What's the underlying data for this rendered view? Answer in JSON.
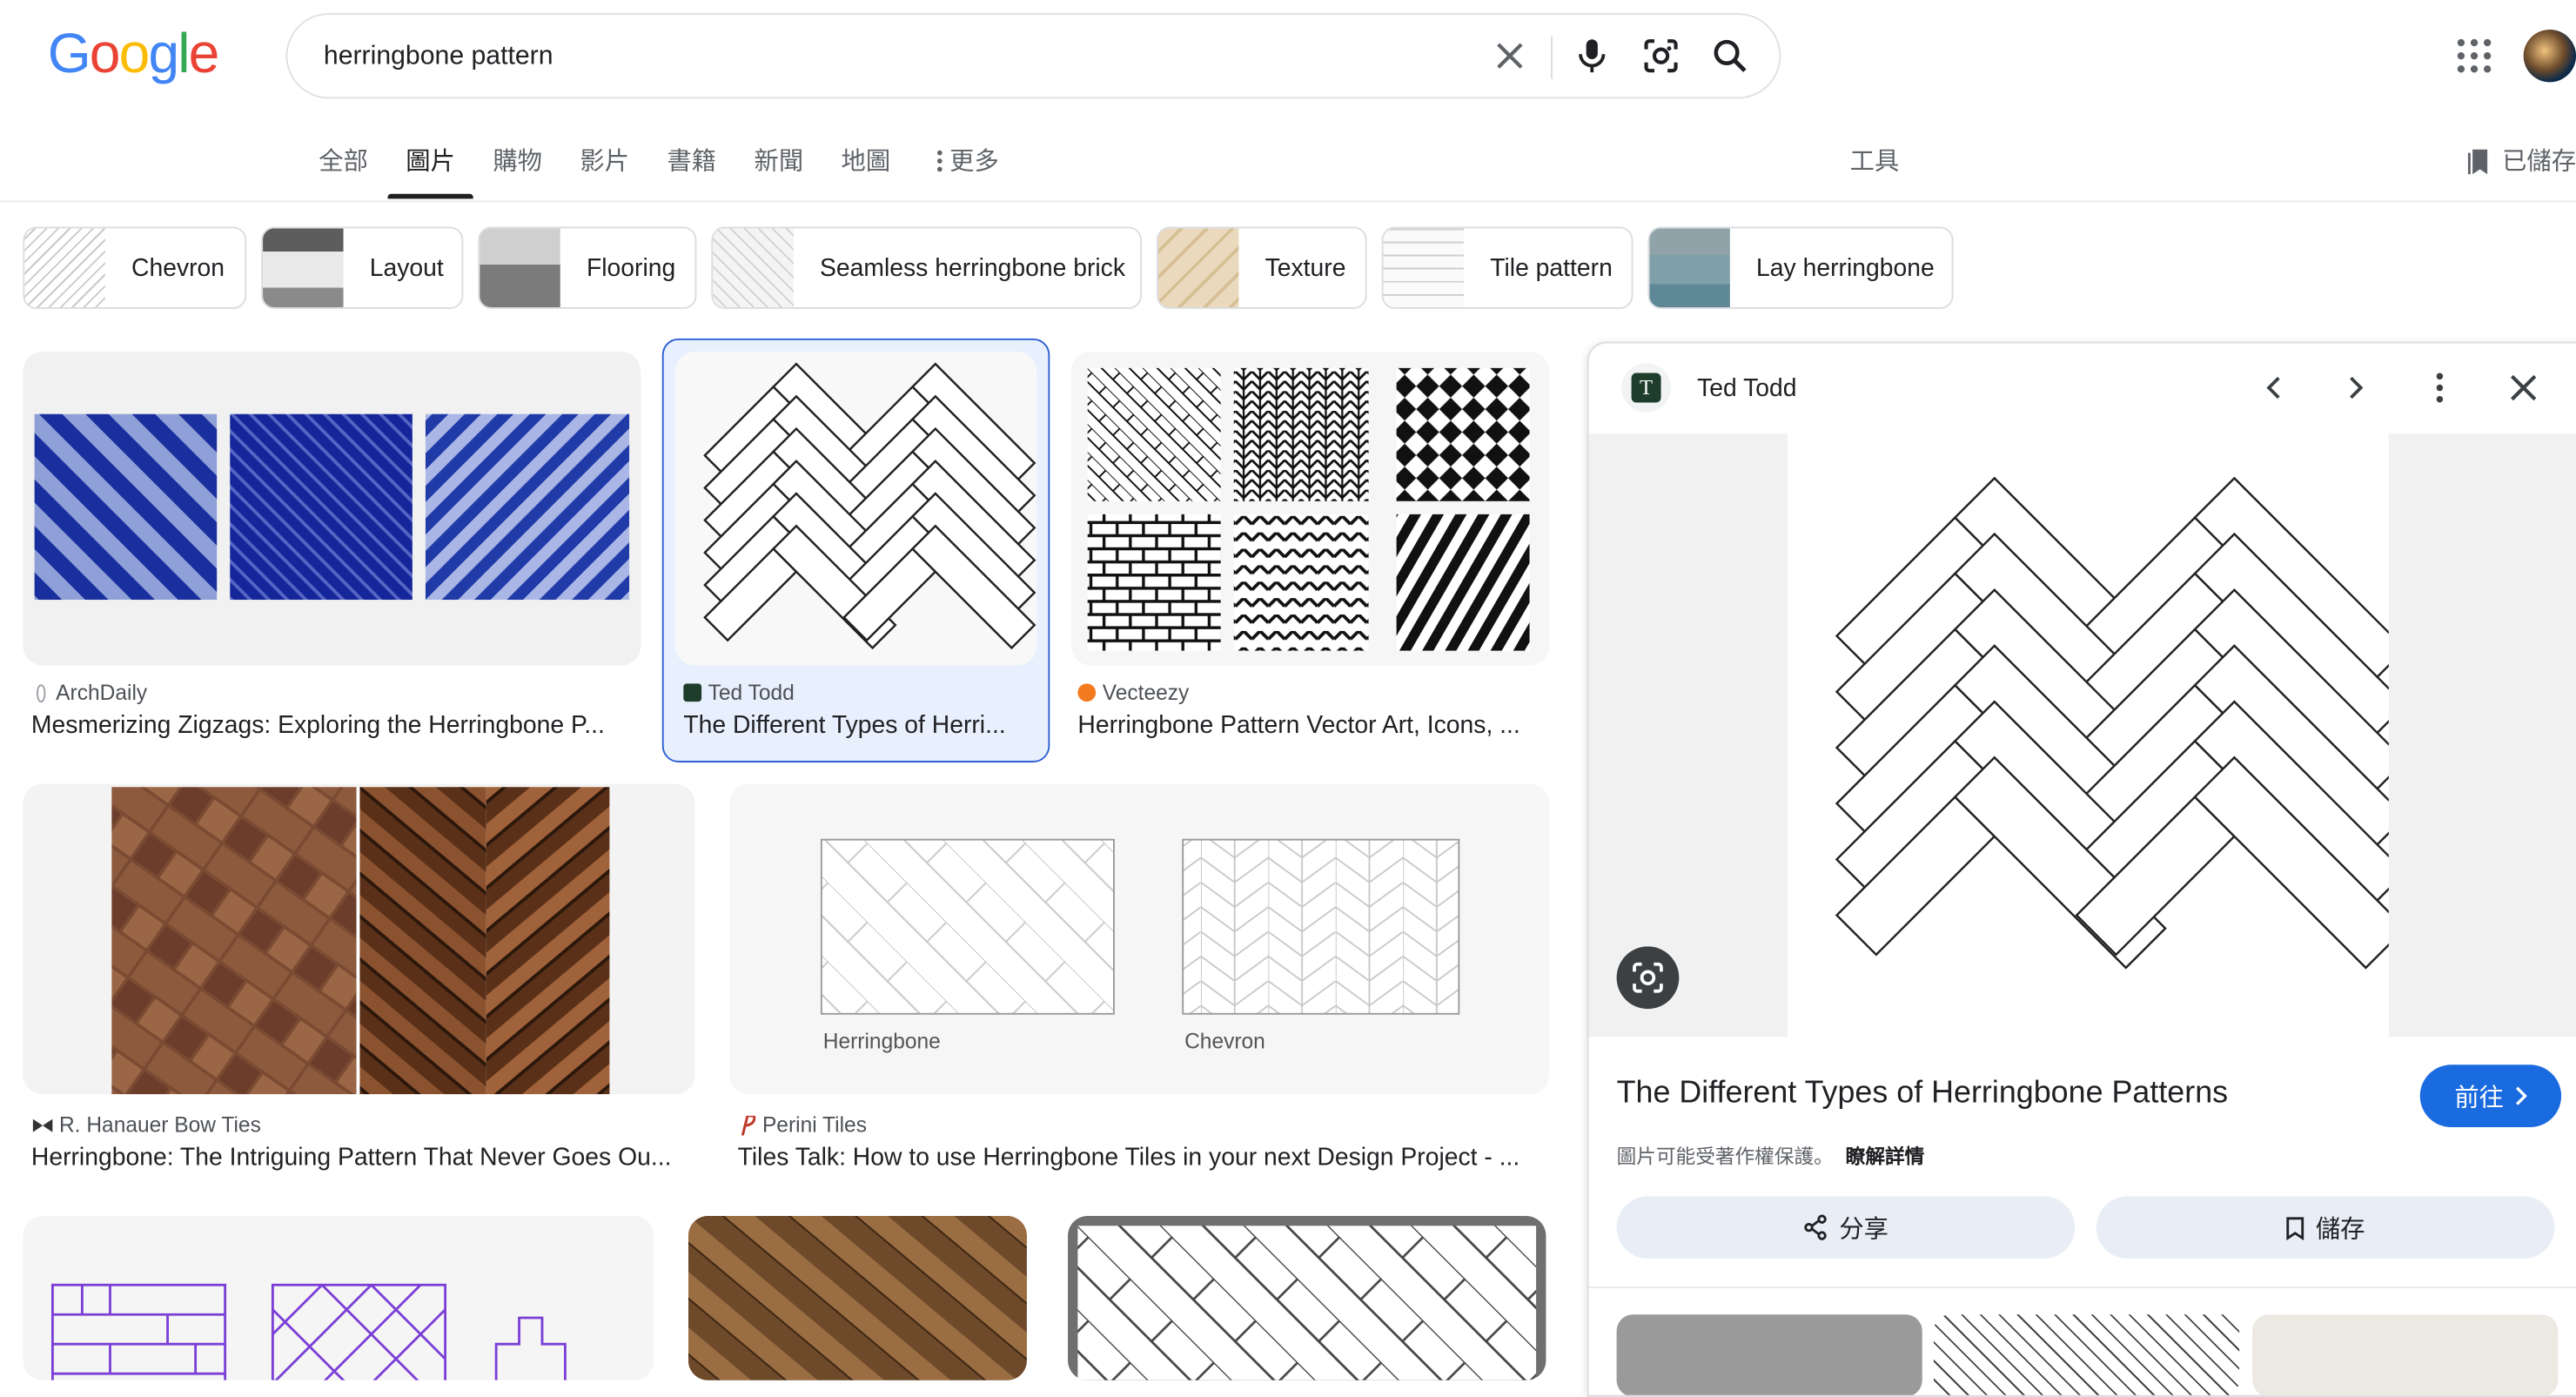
{
  "logo": {
    "text": "Google",
    "colors": [
      "#4285F4",
      "#EA4335",
      "#FBBC05",
      "#4285F4",
      "#34A853",
      "#EA4335"
    ]
  },
  "search": {
    "query": "herringbone pattern"
  },
  "tabs": [
    {
      "label": "全部"
    },
    {
      "label": "圖片"
    },
    {
      "label": "購物"
    },
    {
      "label": "影片"
    },
    {
      "label": "書籍"
    },
    {
      "label": "新聞"
    },
    {
      "label": "地圖"
    },
    {
      "label": "更多"
    }
  ],
  "tools_label": "工具",
  "saved_label": "已儲存",
  "chips": [
    {
      "label": "Chevron"
    },
    {
      "label": "Layout"
    },
    {
      "label": "Flooring"
    },
    {
      "label": "Seamless herringbone brick"
    },
    {
      "label": "Texture"
    },
    {
      "label": "Tile pattern"
    },
    {
      "label": "Lay herringbone"
    }
  ],
  "results": [
    {
      "source": "ArchDaily",
      "title": "Mesmerizing Zigzags: Exploring the Herringbone P..."
    },
    {
      "source": "Ted Todd",
      "title": "The Different Types of Herri..."
    },
    {
      "source": "Vecteezy",
      "title": "Herringbone Pattern Vector Art, Icons, ..."
    },
    {
      "source": "R. Hanauer Bow Ties",
      "title": "Herringbone: The Intriguing Pattern That Never Goes Ou..."
    },
    {
      "source": "Perini Tiles",
      "title": "Tiles Talk: How to use Herringbone Tiles in your next Design Project - ..."
    }
  ],
  "image_captions": {
    "left": "Herringbone",
    "right": "Chevron"
  },
  "panel": {
    "source": "Ted Todd",
    "title": "The Different Types of Herringbone Patterns",
    "visit_label": "前往",
    "copyright_note": "圖片可能受著作權保護。",
    "learn_more": "瞭解詳情",
    "share_label": "分享",
    "save_label": "儲存"
  }
}
